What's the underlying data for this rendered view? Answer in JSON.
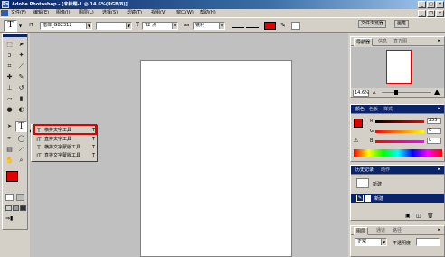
{
  "titlebar": {
    "title": "Adobe Photoshop - [未标题-1 @ 14.6%(RGB/8)]",
    "app_icon": "Ps",
    "min": "_",
    "max": "□",
    "close": "×",
    "doc_min": "_",
    "doc_restore": "❐",
    "doc_close": "×"
  },
  "menubar": {
    "items": [
      "文件(F)",
      "编辑(E)",
      "图像(I)",
      "图层(L)",
      "选择(S)",
      "滤镜(T)",
      "视图(V)",
      "窗口(W)",
      "帮助(H)"
    ],
    "right_items": [
      "文件浏览器",
      "画笔"
    ]
  },
  "optionsbar": {
    "tool_icon": "T",
    "orient_icon": "IT",
    "font_family": "楷体_GB2312",
    "font_style": "",
    "font_size": "72 点",
    "aa_icon": "aa",
    "aa_mode": "锐利",
    "text_color": "#e00000"
  },
  "toolbox": {
    "type_tool": "T"
  },
  "flyout": {
    "items": [
      {
        "icon": "T",
        "label": "横排文字工具",
        "key": "T"
      },
      {
        "icon": "IT",
        "label": "直排文字工具",
        "key": "T"
      },
      {
        "icon": "T",
        "label": "横排文字蒙版工具",
        "key": "T"
      },
      {
        "icon": "IT",
        "label": "直排文字蒙版工具",
        "key": "T"
      }
    ]
  },
  "navigator": {
    "tabs": [
      "导航器",
      "信息",
      "直方图"
    ],
    "zoom": "14.6%"
  },
  "color": {
    "tabs": [
      "颜色",
      "色板",
      "样式"
    ],
    "r_label": "R",
    "g_label": "G",
    "b_label": "B",
    "r_value": "255",
    "g_value": "0",
    "b_value": "0",
    "fg_color": "#e00000"
  },
  "history": {
    "tabs": [
      "历史记录",
      "动作"
    ],
    "snapshot_label": "新建",
    "state_label": "新建"
  },
  "layers": {
    "tabs": [
      "图层",
      "通道",
      "路径"
    ],
    "blend_mode": "正常",
    "opacity_label": "不透明度"
  }
}
